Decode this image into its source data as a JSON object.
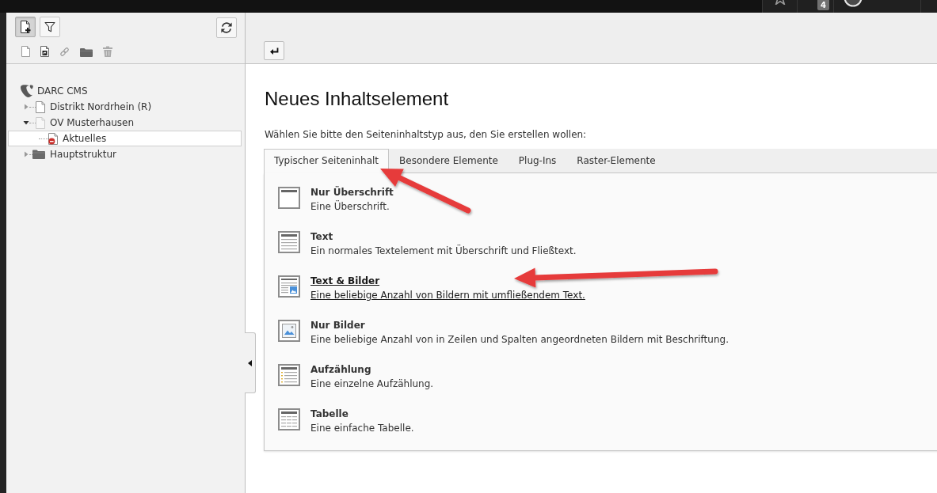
{
  "topbar": {
    "badge": "4"
  },
  "sidebar": {
    "toolbar": [
      {
        "active": true
      },
      {
        "active": false
      }
    ],
    "tree": [
      {
        "label": "DARC CMS",
        "kind": "root",
        "selected": false,
        "children": [
          {
            "label": "Distrikt Nordrhein (R)",
            "kind": "page",
            "expanded": false,
            "selected": false,
            "hidden": false,
            "dimmed": false
          },
          {
            "label": "OV Musterhausen",
            "kind": "page",
            "expanded": true,
            "selected": false,
            "hidden": false,
            "dimmed": true,
            "children": [
              {
                "label": "Aktuelles",
                "kind": "page",
                "selected": true,
                "hidden": true,
                "dimmed": false
              }
            ]
          },
          {
            "label": "Hauptstruktur",
            "kind": "folder",
            "expanded": false,
            "selected": false,
            "hidden": false,
            "dimmed": false
          }
        ]
      }
    ]
  },
  "heading": "Neues Inhaltselement",
  "intro": "Wählen Sie bitte den Seiteninhaltstyp aus, den Sie erstellen wollen:",
  "tabs": [
    {
      "label": "Typischer Seiteninhalt",
      "selected": true
    },
    {
      "label": "Besondere Elemente",
      "selected": false
    },
    {
      "label": "Plug-Ins",
      "selected": false
    },
    {
      "label": "Raster-Elemente",
      "selected": false
    }
  ],
  "content_types": [
    {
      "kind": "header",
      "title": "Nur Überschrift",
      "description": "Eine Überschrift.",
      "hovered": false
    },
    {
      "kind": "text",
      "title": "Text",
      "description": "Ein normales Textelement mit Überschrift und Fließtext.",
      "hovered": false
    },
    {
      "kind": "textpic",
      "title": "Text & Bilder",
      "description": "Eine beliebige Anzahl von Bildern mit umfließendem Text.",
      "hovered": true
    },
    {
      "kind": "image",
      "title": "Nur Bilder",
      "description": "Eine beliebige Anzahl von in Zeilen und Spalten angeordneten Bildern mit Beschriftung.",
      "hovered": false
    },
    {
      "kind": "bullets",
      "title": "Aufzählung",
      "description": "Eine einzelne Aufzählung.",
      "hovered": false
    },
    {
      "kind": "table",
      "title": "Tabelle",
      "description": "Eine einfache Tabelle.",
      "hovered": false
    }
  ],
  "annotations": [
    {
      "kind": "arrow"
    },
    {
      "kind": "arrow"
    }
  ]
}
